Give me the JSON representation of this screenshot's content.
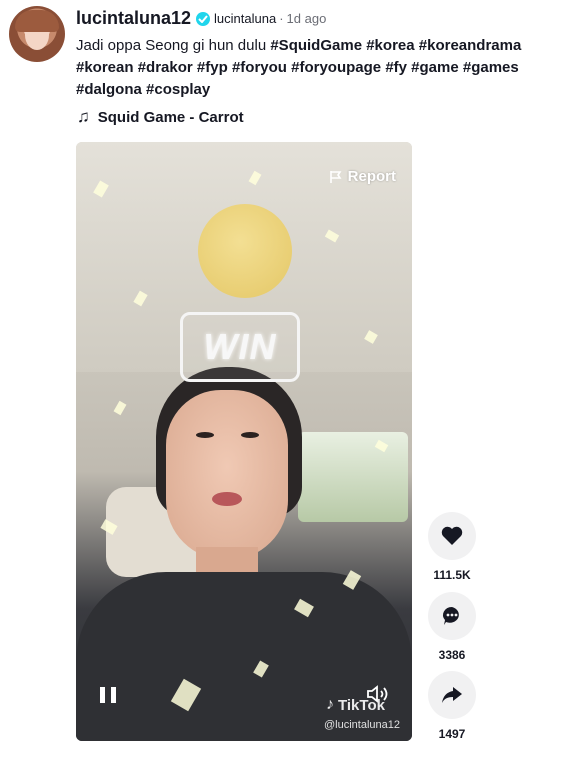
{
  "post": {
    "username": "lucintaluna12",
    "nickname": "lucintaluna",
    "separator": "·",
    "time": "1d ago",
    "caption_text": "Jadi oppa Seong gi hun dulu",
    "hashtags": [
      "#SquidGame",
      "#korea",
      "#koreandrama",
      "#korean",
      "#drakor",
      "#fyp",
      "#foryou",
      "#foryoupage",
      "#fy",
      "#game",
      "#games",
      "#dalgona",
      "#cosplay"
    ],
    "music": "Squid Game - Carrot"
  },
  "video": {
    "report_label": "Report",
    "overlay_sign": "WIN",
    "watermark_brand": "TikTok",
    "watermark_handle": "@lucintaluna12"
  },
  "actions": {
    "likes": "111.5K",
    "comments": "3386",
    "shares": "1497"
  },
  "colors": {
    "text": "#161823",
    "muted": "#6b6d75",
    "verified": "#20d5ec",
    "action_bg": "#f1f1f2"
  },
  "icons": [
    "verified-badge-icon",
    "music-note-icon",
    "flag-icon",
    "pause-icon",
    "volume-icon",
    "tiktok-logo-icon",
    "heart-icon",
    "comment-icon",
    "share-icon"
  ]
}
